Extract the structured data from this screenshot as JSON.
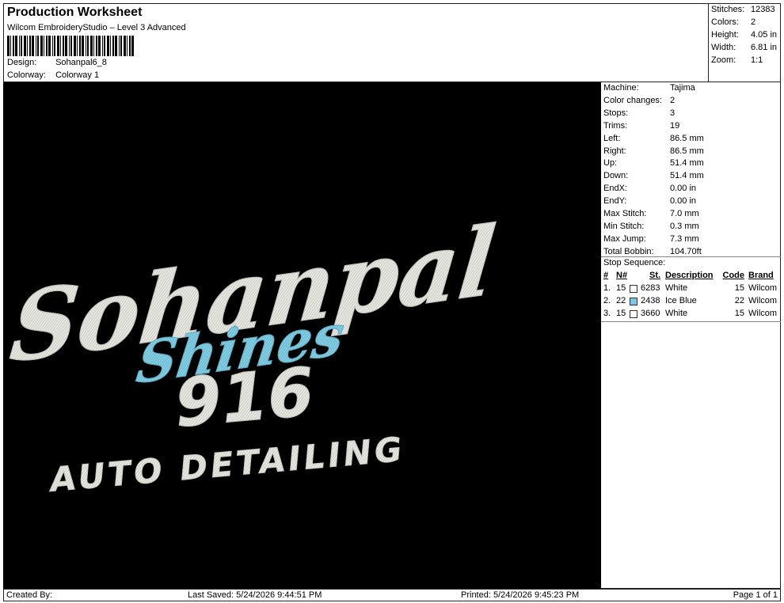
{
  "header": {
    "title": "Production Worksheet",
    "subtitle": "Wilcom EmbroideryStudio – Level 3 Advanced",
    "design_label": "Design:",
    "design_value": "Sohanpal6_8",
    "colorway_label": "Colorway:",
    "colorway_value": "Colorway 1"
  },
  "stats": [
    {
      "label": "Stitches:",
      "value": "12383"
    },
    {
      "label": "Colors:",
      "value": "2"
    },
    {
      "label": "Height:",
      "value": "4.05 in"
    },
    {
      "label": "Width:",
      "value": "6.81 in"
    },
    {
      "label": "Zoom:",
      "value": "1:1"
    }
  ],
  "machine_info": [
    {
      "label": "Machine:",
      "value": "Tajima"
    },
    {
      "label": "Color changes:",
      "value": "2"
    },
    {
      "label": "Stops:",
      "value": "3"
    },
    {
      "label": "Trims:",
      "value": "19"
    },
    {
      "label": "Left:",
      "value": "86.5 mm"
    },
    {
      "label": "Right:",
      "value": "86.5 mm"
    },
    {
      "label": "Up:",
      "value": "51.4 mm"
    },
    {
      "label": "Down:",
      "value": "51.4 mm"
    },
    {
      "label": "EndX:",
      "value": "0.00 in"
    },
    {
      "label": "EndY:",
      "value": "0.00 in"
    },
    {
      "label": "Max Stitch:",
      "value": "7.0 mm"
    },
    {
      "label": "Min Stitch:",
      "value": "0.3 mm"
    },
    {
      "label": "Max Jump:",
      "value": "7.3 mm"
    },
    {
      "label": "Total Bobbin:",
      "value": "104.70ft"
    }
  ],
  "stop_sequence": {
    "title": "Stop Sequence:",
    "headers": {
      "num": "#",
      "n": "N#",
      "st": "St.",
      "desc": "Description",
      "code": "Code",
      "brand": "Brand"
    },
    "rows": [
      {
        "num": "1.",
        "n": "15",
        "swatch": "#ffffff",
        "st": "6283",
        "desc": "White",
        "code": "15",
        "brand": "Wilcom"
      },
      {
        "num": "2.",
        "n": "22",
        "swatch": "#7fc4e6",
        "st": "2438",
        "desc": "Ice Blue",
        "code": "22",
        "brand": "Wilcom"
      },
      {
        "num": "3.",
        "n": "15",
        "swatch": "#ffffff",
        "st": "3660",
        "desc": "White",
        "code": "15",
        "brand": "Wilcom"
      }
    ]
  },
  "design_text": {
    "line1": "Sohanpal",
    "line2": "Shines",
    "line3": "916",
    "line4": "AUTO DETAILING"
  },
  "colors": {
    "white_thread": "#e9e9e4",
    "ice_blue_thread": "#86cfe3",
    "background": "#000000"
  },
  "footer": {
    "created_by": "Created By:",
    "last_saved": "Last Saved: 5/24/2026 9:44:51 PM",
    "printed": "Printed: 5/24/2026 9:45:23 PM",
    "page": "Page 1 of 1"
  }
}
